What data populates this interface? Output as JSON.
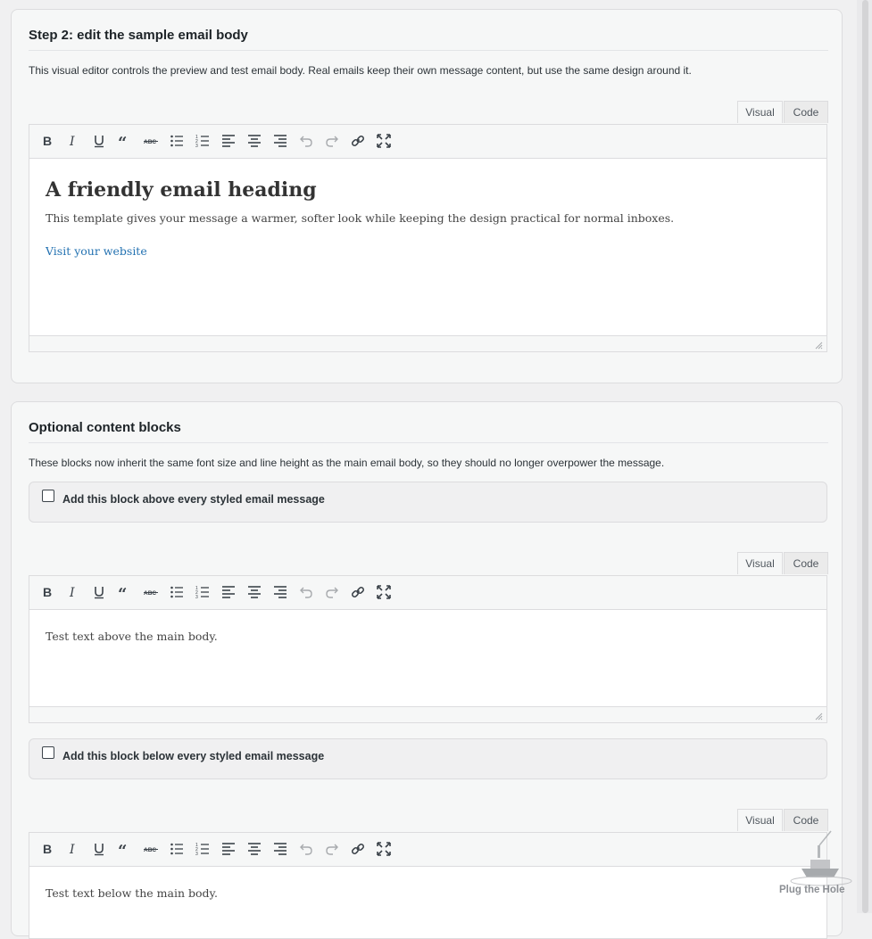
{
  "step2": {
    "title": "Step 2: edit the sample email body",
    "description": "This visual editor controls the preview and test email body. Real emails keep their own message content, but use the same design around it.",
    "tabs": {
      "visual": "Visual",
      "code": "Code"
    },
    "editor": {
      "heading": "A friendly email heading",
      "paragraph": "This template gives your message a warmer, softer look while keeping the design practical for normal inboxes.",
      "link": "Visit your website"
    }
  },
  "optional": {
    "title": "Optional content blocks",
    "description": "These blocks now inherit the same font size and line height as the main email body, so they should no longer overpower the message.",
    "above": {
      "label": "Add this block above every styled email message",
      "checked": false,
      "tabs": {
        "visual": "Visual",
        "code": "Code"
      },
      "text": "Test text above the main body."
    },
    "below": {
      "label": "Add this block below every styled email message",
      "checked": false,
      "tabs": {
        "visual": "Visual",
        "code": "Code"
      },
      "text": "Test text below the main body."
    }
  },
  "toolbar_icons": [
    "bold-icon",
    "italic-icon",
    "underline-icon",
    "blockquote-icon",
    "strikethrough-icon",
    "bullet-list-icon",
    "numbered-list-icon",
    "align-left-icon",
    "align-center-icon",
    "align-right-icon",
    "undo-icon",
    "redo-icon",
    "link-icon",
    "fullscreen-icon"
  ],
  "watermark": {
    "text": "Plug the Hole"
  },
  "colors": {
    "link": "#2271b1",
    "panel": "#f6f7f7",
    "border": "#dcdcde"
  }
}
